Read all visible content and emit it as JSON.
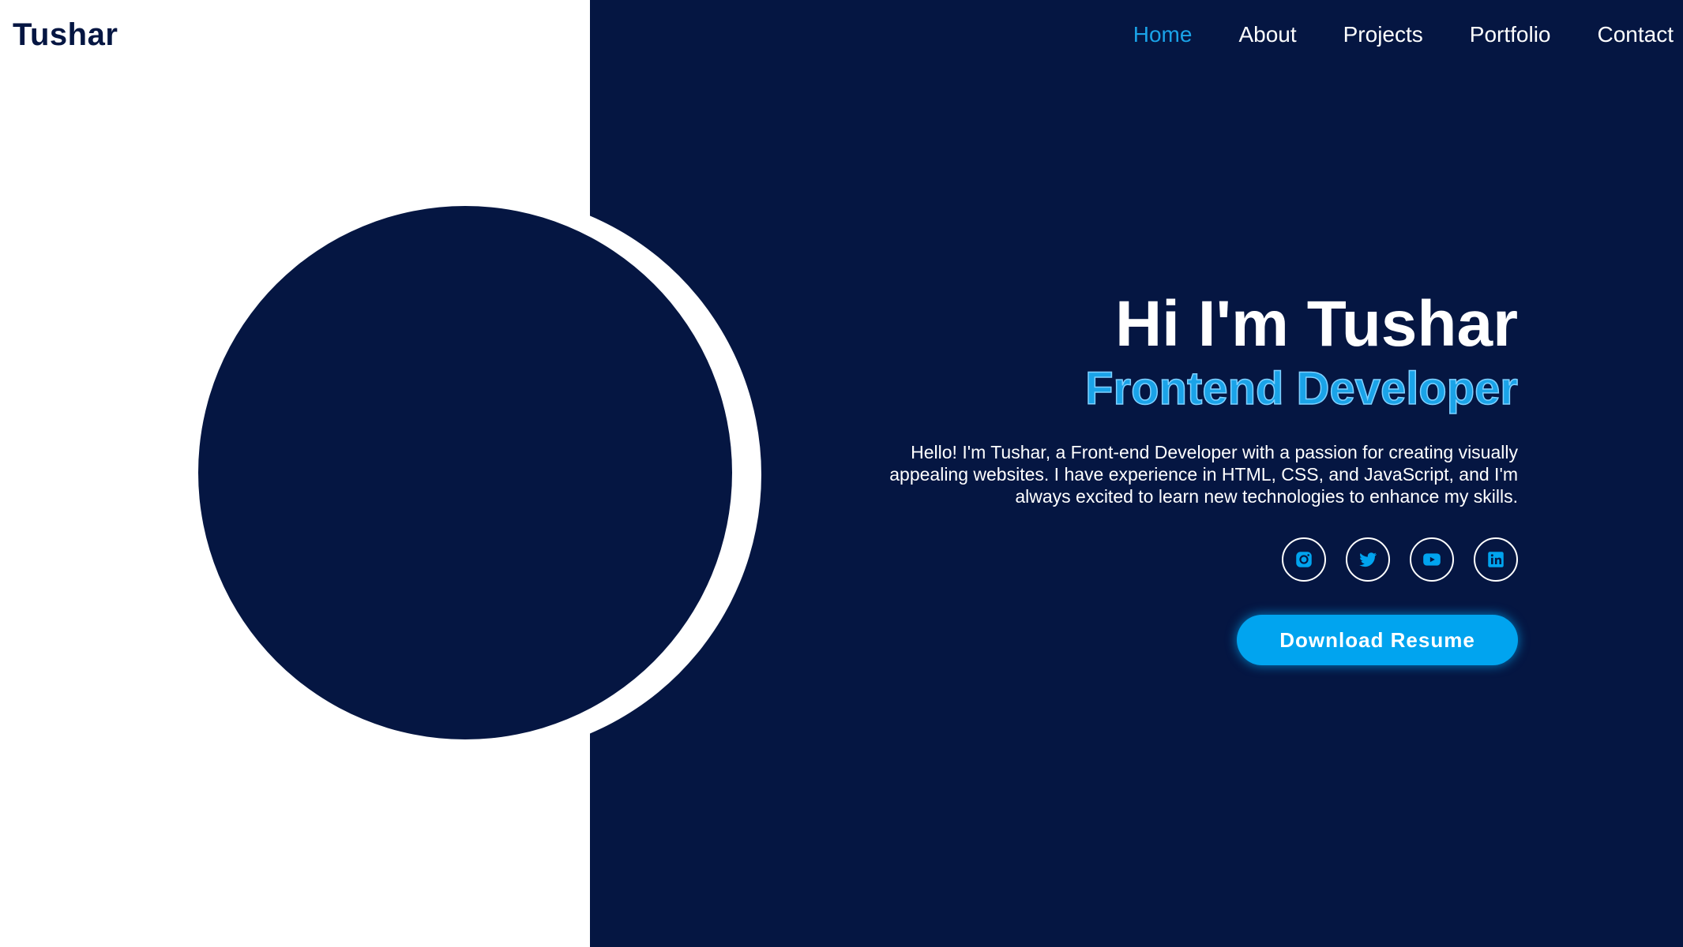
{
  "brand": {
    "name": "Tushar"
  },
  "nav": {
    "items": [
      {
        "label": "Home",
        "active": true
      },
      {
        "label": "About",
        "active": false
      },
      {
        "label": "Projects",
        "active": false
      },
      {
        "label": "Portfolio",
        "active": false
      },
      {
        "label": "Contact",
        "active": false
      }
    ]
  },
  "hero": {
    "title": "Hi I'm Tushar",
    "subtitle": "Frontend Developer",
    "description": "Hello! I'm Tushar, a Front-end Developer with a passion for creating visually appealing websites. I have experience in HTML, CSS, and JavaScript, and I'm always excited to learn new technologies to enhance my skills.",
    "socials": [
      {
        "icon": "instagram-icon"
      },
      {
        "icon": "twitter-icon"
      },
      {
        "icon": "youtube-icon"
      },
      {
        "icon": "linkedin-icon"
      }
    ],
    "cta_label": "Download Resume"
  },
  "colors": {
    "navy": "#051642",
    "accent": "#01a4ef",
    "white": "#ffffff"
  }
}
